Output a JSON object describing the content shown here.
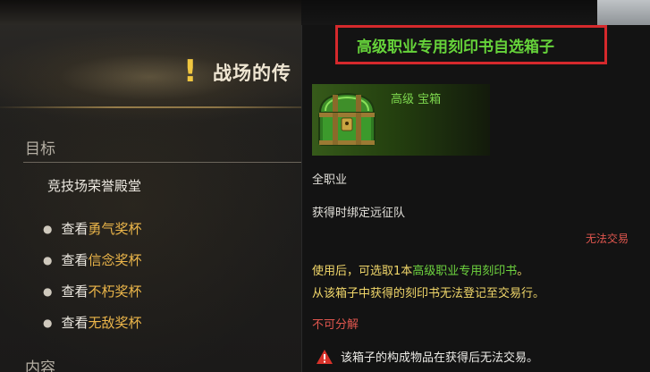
{
  "quest": {
    "title": "战场的传",
    "objective_section": "目标",
    "objective_header": "竞技场荣誉殿堂",
    "objectives": [
      {
        "prefix": "查看",
        "highlight": "勇气奖杯"
      },
      {
        "prefix": "查看",
        "highlight": "信念奖杯"
      },
      {
        "prefix": "查看",
        "highlight": "不朽奖杯"
      },
      {
        "prefix": "查看",
        "highlight": "无敌奖杯"
      }
    ],
    "content_section": "内容"
  },
  "tooltip": {
    "item_name": "高级职业专用刻印书自选箱子",
    "grade": "高级 宝箱",
    "class_restriction": "全职业",
    "bind_info": "获得时绑定远征队",
    "trade_status": "无法交易",
    "desc": {
      "part1": "使用后，可选取1本",
      "part2": "高级职业专用刻印书",
      "part3": "。"
    },
    "desc_line2": "从该箱子中获得的刻印书无法登记至交易行。",
    "dismantle": "不可分解",
    "warning": "该箱子的构成物品在获得后无法交易。"
  },
  "colors": {
    "item_name": "#66d33a",
    "highlight_gold": "#ecb64a",
    "warning_red": "#e0564e",
    "title_box_border": "#d5292c"
  }
}
